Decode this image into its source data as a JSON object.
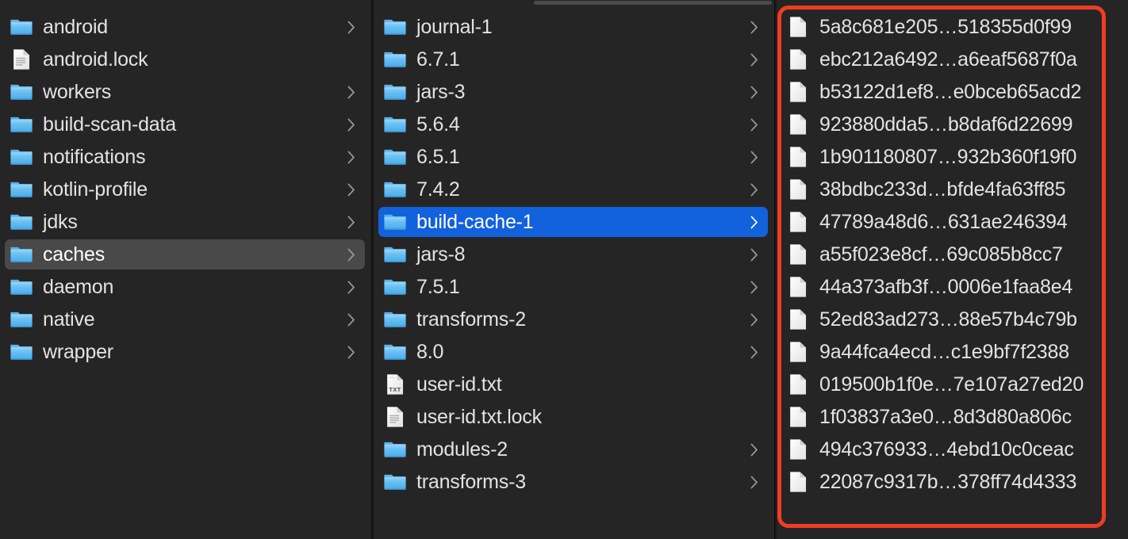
{
  "window": {
    "title": "Finder Column View",
    "background_color": "#262525",
    "selection_active_color": "#1261dd",
    "selection_inactive_color": "#4a4949",
    "annotation_color": "#ef3d23"
  },
  "scrollbar": {
    "name": "horizontal-scrollbar",
    "visible": true
  },
  "columns": [
    {
      "name": "column-gradle-home",
      "items": [
        {
          "label": "android",
          "icon": "folder-icon",
          "chevron": true,
          "selected": "none"
        },
        {
          "label": "android.lock",
          "icon": "document-icon",
          "chevron": false,
          "selected": "none"
        },
        {
          "label": "workers",
          "icon": "folder-icon",
          "chevron": true,
          "selected": "none"
        },
        {
          "label": "build-scan-data",
          "icon": "folder-icon",
          "chevron": true,
          "selected": "none"
        },
        {
          "label": "notifications",
          "icon": "folder-icon",
          "chevron": true,
          "selected": "none"
        },
        {
          "label": "kotlin-profile",
          "icon": "folder-icon",
          "chevron": true,
          "selected": "none"
        },
        {
          "label": "jdks",
          "icon": "folder-icon",
          "chevron": true,
          "selected": "none"
        },
        {
          "label": "caches",
          "icon": "folder-icon",
          "chevron": true,
          "selected": "inactive"
        },
        {
          "label": "daemon",
          "icon": "folder-icon",
          "chevron": true,
          "selected": "none"
        },
        {
          "label": "native",
          "icon": "folder-icon",
          "chevron": true,
          "selected": "none"
        },
        {
          "label": "wrapper",
          "icon": "folder-icon",
          "chevron": true,
          "selected": "none"
        }
      ]
    },
    {
      "name": "column-caches",
      "items": [
        {
          "label": "journal-1",
          "icon": "folder-icon",
          "chevron": true,
          "selected": "none"
        },
        {
          "label": "6.7.1",
          "icon": "folder-icon",
          "chevron": true,
          "selected": "none"
        },
        {
          "label": "jars-3",
          "icon": "folder-icon",
          "chevron": true,
          "selected": "none"
        },
        {
          "label": "5.6.4",
          "icon": "folder-icon",
          "chevron": true,
          "selected": "none"
        },
        {
          "label": "6.5.1",
          "icon": "folder-icon",
          "chevron": true,
          "selected": "none"
        },
        {
          "label": "7.4.2",
          "icon": "folder-icon",
          "chevron": true,
          "selected": "none"
        },
        {
          "label": "build-cache-1",
          "icon": "folder-icon",
          "chevron": true,
          "selected": "active"
        },
        {
          "label": "jars-8",
          "icon": "folder-icon",
          "chevron": true,
          "selected": "none"
        },
        {
          "label": "7.5.1",
          "icon": "folder-icon",
          "chevron": true,
          "selected": "none"
        },
        {
          "label": "transforms-2",
          "icon": "folder-icon",
          "chevron": true,
          "selected": "none"
        },
        {
          "label": "8.0",
          "icon": "folder-icon",
          "chevron": true,
          "selected": "none"
        },
        {
          "label": "user-id.txt",
          "icon": "txt-file-icon",
          "chevron": false,
          "selected": "none"
        },
        {
          "label": "user-id.txt.lock",
          "icon": "document-icon",
          "chevron": false,
          "selected": "none"
        },
        {
          "label": "modules-2",
          "icon": "folder-icon",
          "chevron": true,
          "selected": "none"
        },
        {
          "label": "transforms-3",
          "icon": "folder-icon",
          "chevron": true,
          "selected": "none"
        }
      ]
    },
    {
      "name": "column-build-cache-1",
      "items": [
        {
          "label": "5a8c681e205…518355d0f99",
          "icon": "blank-file-icon",
          "chevron": false,
          "selected": "none"
        },
        {
          "label": "ebc212a6492…a6eaf5687f0a",
          "icon": "blank-file-icon",
          "chevron": false,
          "selected": "none"
        },
        {
          "label": "b53122d1ef8…e0bceb65acd2",
          "icon": "blank-file-icon",
          "chevron": false,
          "selected": "none"
        },
        {
          "label": "923880dda5…b8daf6d22699",
          "icon": "blank-file-icon",
          "chevron": false,
          "selected": "none"
        },
        {
          "label": "1b901180807…932b360f19f0",
          "icon": "blank-file-icon",
          "chevron": false,
          "selected": "none"
        },
        {
          "label": "38bdbc233d…bfde4fa63ff85",
          "icon": "blank-file-icon",
          "chevron": false,
          "selected": "none"
        },
        {
          "label": "47789a48d6…631ae246394",
          "icon": "blank-file-icon",
          "chevron": false,
          "selected": "none"
        },
        {
          "label": "a55f023e8cf…69c085b8cc7",
          "icon": "blank-file-icon",
          "chevron": false,
          "selected": "none"
        },
        {
          "label": "44a373afb3f…0006e1faa8e4",
          "icon": "blank-file-icon",
          "chevron": false,
          "selected": "none"
        },
        {
          "label": "52ed83ad273…88e57b4c79b",
          "icon": "blank-file-icon",
          "chevron": false,
          "selected": "none"
        },
        {
          "label": "9a44fca4ecd…c1e9bf7f2388",
          "icon": "blank-file-icon",
          "chevron": false,
          "selected": "none"
        },
        {
          "label": "019500b1f0e…7e107a27ed20",
          "icon": "blank-file-icon",
          "chevron": false,
          "selected": "none"
        },
        {
          "label": "1f03837a3e0…8d3d80a806c",
          "icon": "blank-file-icon",
          "chevron": false,
          "selected": "none"
        },
        {
          "label": "494c376933…4ebd10c0ceac",
          "icon": "blank-file-icon",
          "chevron": false,
          "selected": "none"
        },
        {
          "label": "22087c9317b…378ff74d4333",
          "icon": "blank-file-icon",
          "chevron": false,
          "selected": "none"
        }
      ]
    }
  ]
}
